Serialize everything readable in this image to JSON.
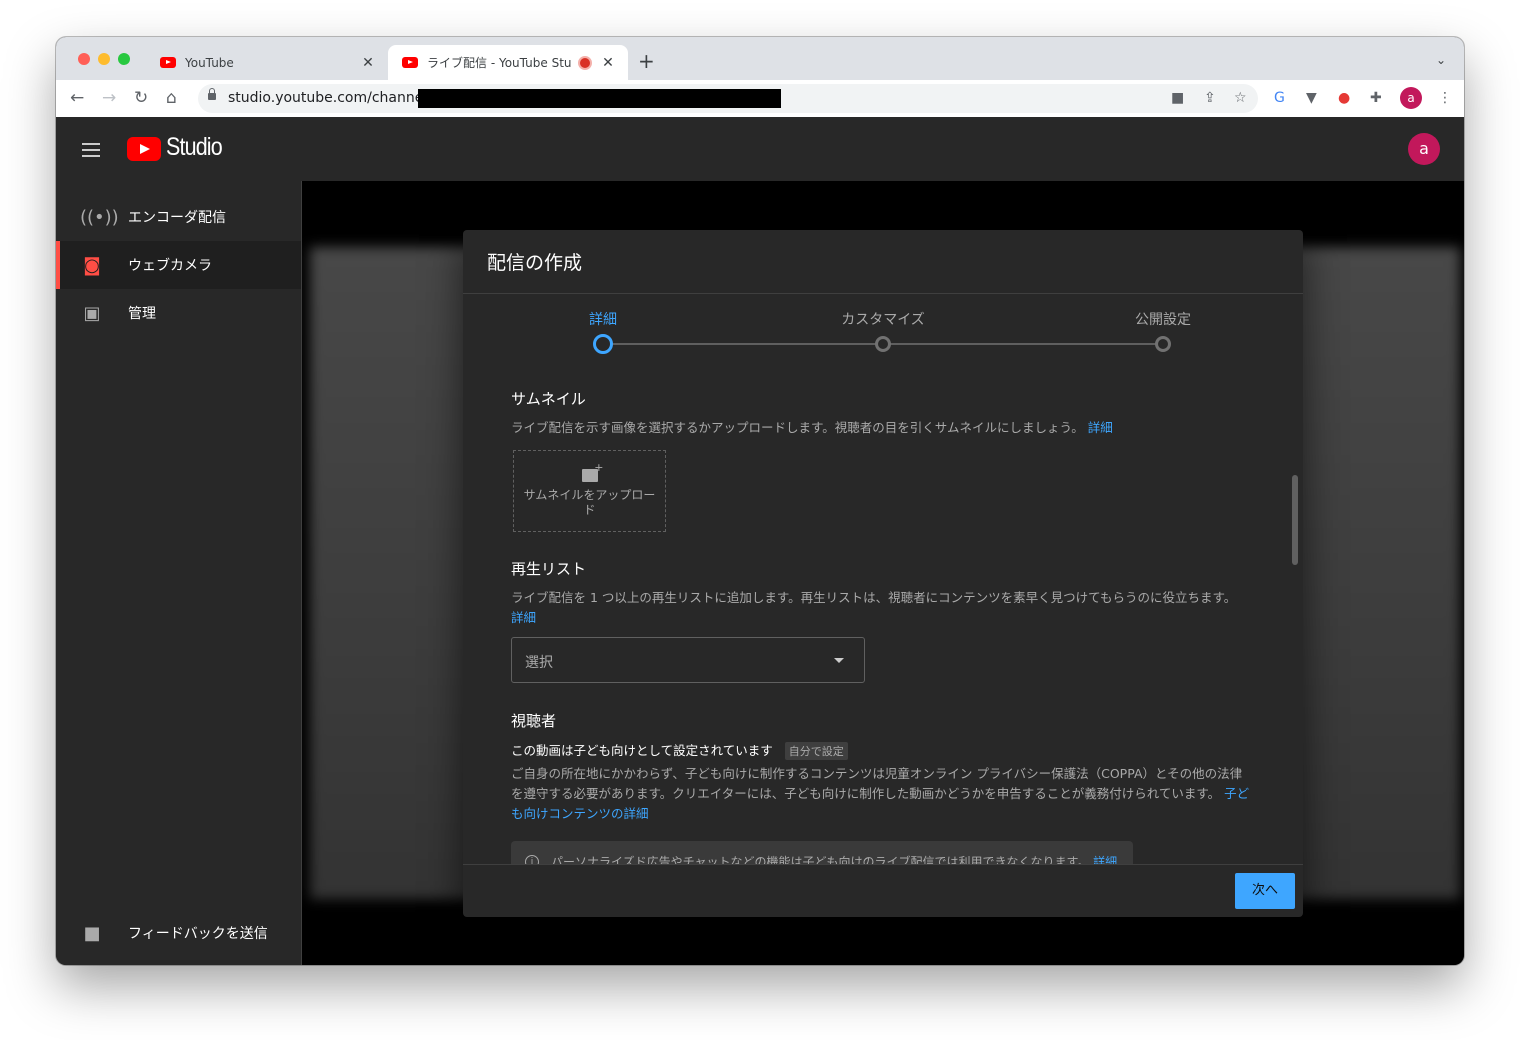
{
  "browser": {
    "tabs": [
      {
        "title": "YouTube"
      },
      {
        "title": "ライブ配信 - YouTube Studio"
      }
    ],
    "url": "studio.youtube.com/channel",
    "profile_initial": "a"
  },
  "studio": {
    "logo_text": "Studio",
    "avatar_initial": "a",
    "sidebar": {
      "items": [
        {
          "label": "エンコーダ配信",
          "icon": "broadcast-icon"
        },
        {
          "label": "ウェブカメラ",
          "icon": "camera-icon",
          "active": true
        },
        {
          "label": "管理",
          "icon": "calendar-icon"
        }
      ],
      "feedback_label": "フィードバックを送信"
    }
  },
  "dialog": {
    "title": "配信の作成",
    "steps": [
      "詳細",
      "カスタマイズ",
      "公開設定"
    ],
    "active_step": 0,
    "thumbnail": {
      "title": "サムネイル",
      "desc": "ライブ配信を示す画像を選択するかアップロードします。視聴者の目を引くサムネイルにしましょう。",
      "link": "詳細",
      "upload_label": "サムネイルをアップロード"
    },
    "playlist": {
      "title": "再生リスト",
      "desc": "ライブ配信を 1 つ以上の再生リストに追加します。再生リストは、視聴者にコンテンツを素早く見つけてもらうのに役立ちます。",
      "link": "詳細",
      "select_placeholder": "選択"
    },
    "audience": {
      "title": "視聴者",
      "status": "この動画は子ども向けとして設定されています",
      "badge": "自分で設定",
      "desc": "ご自身の所在地にかかわらず、子ども向けに制作するコンテンツは児童オンライン プライバシー保護法（COPPA）とその他の法律を遵守する必要があります。クリエイターには、子ども向けに制作した動画かどうかを申告することが義務付けられています。",
      "link": "子ども向けコンテンツの詳細",
      "info": "パーソナライズド広告やチャットなどの機能は子ども向けのライブ配信では利用できなくなります。",
      "info_link": "詳細"
    },
    "next_label": "次へ"
  },
  "colors": {
    "accent": "#3ea6ff",
    "brand": "#ff0000",
    "active_indicator": "#ff4e45"
  }
}
